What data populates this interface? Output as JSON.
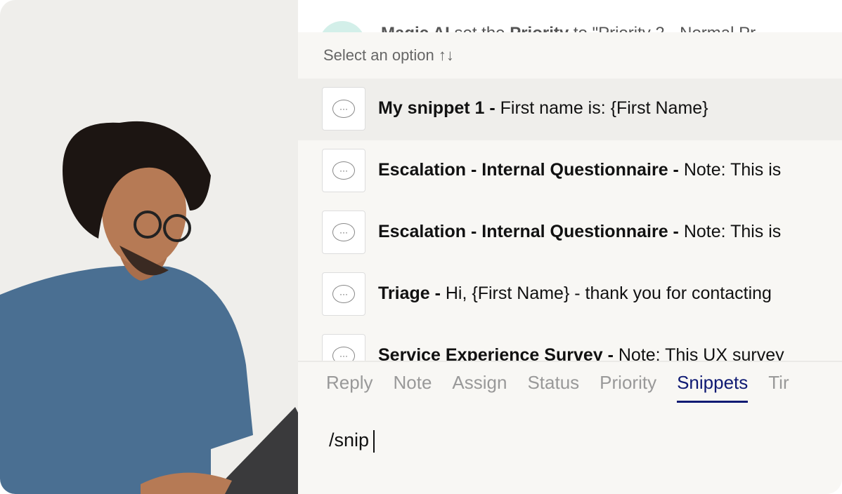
{
  "activity": {
    "actor": "Magic AI",
    "middle": " set the ",
    "field": "Priority",
    "rest": " to \"Priority 2 - Normal Pr"
  },
  "select_hint": "Select an option ↑↓",
  "snippets": [
    {
      "title": "My snippet 1 - ",
      "body": "First name is: {First Name}",
      "active": true
    },
    {
      "title": "Escalation - Internal Questionnaire - ",
      "body": "Note: This is"
    },
    {
      "title": "Escalation - Internal Questionnaire - ",
      "body": "Note: This is"
    },
    {
      "title": "Triage - ",
      "body": "Hi, {First Name} - thank you for contacting"
    },
    {
      "title": "Service Experience Survey - ",
      "body": "Note: This UX survey"
    }
  ],
  "tabs": [
    "Reply",
    "Note",
    "Assign",
    "Status",
    "Priority",
    "Snippets",
    "Tir"
  ],
  "active_tab": "Snippets",
  "composer": {
    "value": "/snip"
  },
  "colors": {
    "accent": "#0f1a73",
    "panel": "#f8f7f4",
    "avatar": "#d3efe9"
  }
}
